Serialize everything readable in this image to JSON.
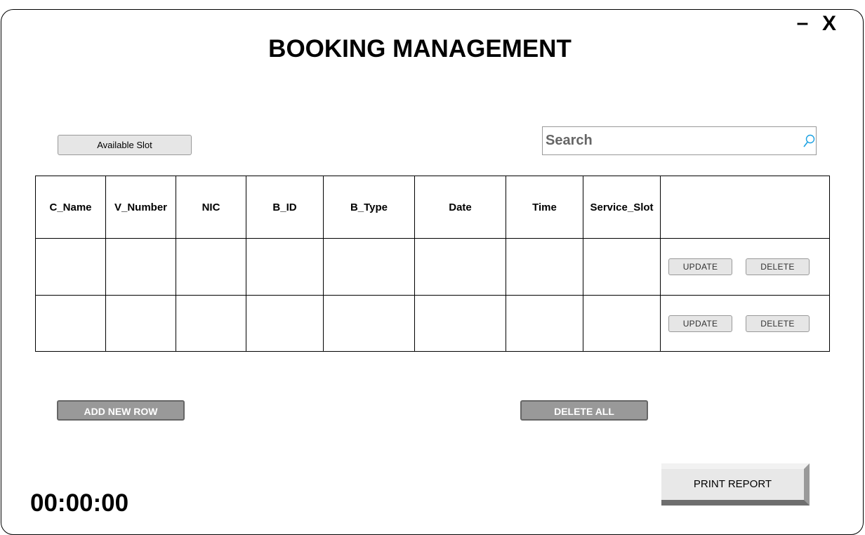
{
  "window": {
    "title": "BOOKING MANAGEMENT",
    "minimize_label": "–",
    "close_label": "X"
  },
  "toolbar": {
    "available_slot_label": "Available Slot",
    "search": {
      "placeholder": "Search",
      "value": "",
      "icon": "search-icon"
    }
  },
  "table": {
    "columns": [
      "C_Name",
      "V_Number",
      "NIC",
      "B_ID",
      "B_Type",
      "Date",
      "Time",
      "Service_Slot",
      ""
    ],
    "rows": [
      {
        "cells": [
          "",
          "",
          "",
          "",
          "",
          "",
          "",
          ""
        ],
        "update_label": "UPDATE",
        "delete_label": "DELETE"
      },
      {
        "cells": [
          "",
          "",
          "",
          "",
          "",
          "",
          "",
          ""
        ],
        "update_label": "UPDATE",
        "delete_label": "DELETE"
      }
    ]
  },
  "actions": {
    "add_new_row_label": "ADD NEW ROW",
    "delete_all_label": "DELETE ALL",
    "print_report_label": "PRINT REPORT"
  },
  "timer": "00:00:00",
  "colors": {
    "button_light": "#e6e6e6",
    "button_dark": "#999999",
    "search_icon": "#1ba1e2",
    "border": "#000000"
  }
}
